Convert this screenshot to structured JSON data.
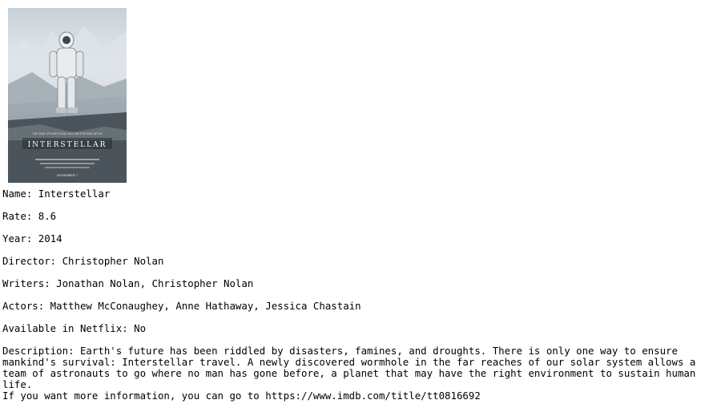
{
  "poster": {
    "tagline": "THE END OF EARTH WILL NOT BE THE END OF US",
    "title": "INTERSTELLAR",
    "release": "NOVEMBER 7"
  },
  "fields": {
    "name": "Name: Interstellar",
    "rate": "Rate: 8.6",
    "year": "Year: 2014",
    "director": "Director: Christopher Nolan",
    "writers": "Writers: Jonathan Nolan, Christopher Nolan",
    "actors": "Actors: Matthew McConaughey, Anne Hathaway, Jessica Chastain",
    "netflix": "Available in Netflix: No",
    "description": "Description: Earth's future has been riddled by disasters, famines, and droughts. There is only one way to ensure mankind's survival: Interstellar travel. A newly discovered wormhole in the far reaches of our solar system allows a team of astronauts to go where no man has gone before, a planet that may have the right environment to sustain human life.",
    "more_info": "If you want more information, you can go to https://www.imdb.com/title/tt0816692"
  }
}
